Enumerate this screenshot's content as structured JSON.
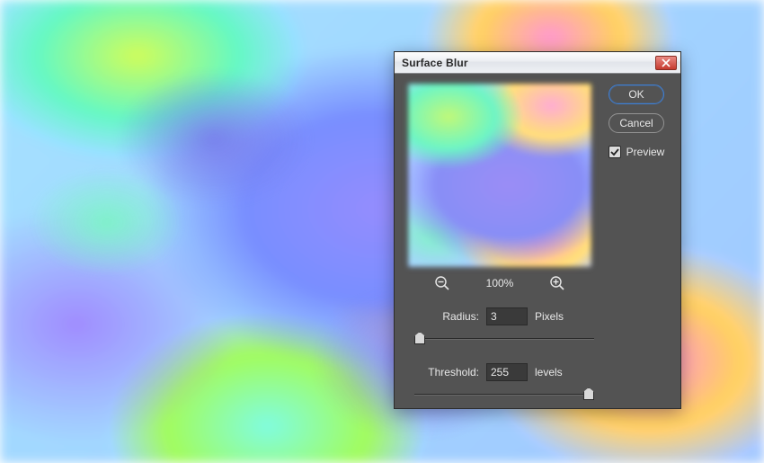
{
  "dialog": {
    "title": "Surface Blur",
    "buttons": {
      "ok": "OK",
      "cancel": "Cancel"
    },
    "preview_label": "Preview",
    "preview_checked": true,
    "zoom": {
      "level": "100%"
    },
    "radius": {
      "label": "Radius:",
      "value": "3",
      "unit": "Pixels",
      "min": 1,
      "max": 100
    },
    "threshold": {
      "label": "Threshold:",
      "value": "255",
      "unit": "levels",
      "min": 0,
      "max": 255
    }
  }
}
